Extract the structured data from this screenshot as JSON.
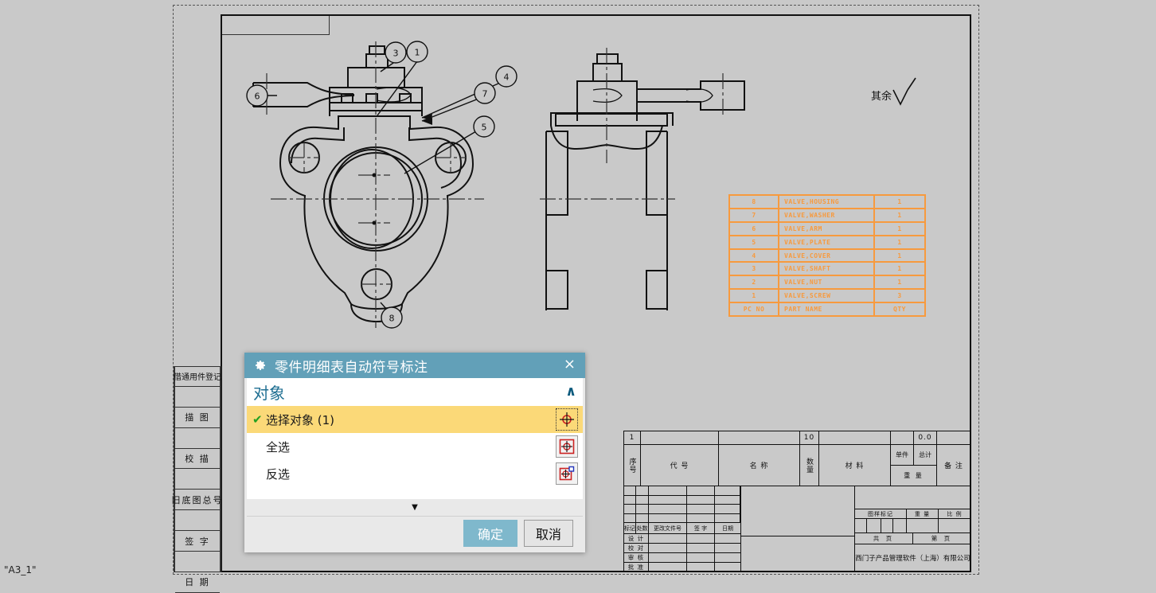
{
  "canvas": {
    "sheet_label": "\"A3_1\"",
    "surface_note": "其余",
    "balloons": [
      "3",
      "1",
      "4",
      "7",
      "6",
      "5",
      "8"
    ]
  },
  "bom": {
    "columns": [
      "PC NO",
      "PART NAME",
      "QTY"
    ],
    "rows": [
      {
        "no": "8",
        "name": "VALVE,HOUSING",
        "qty": "1"
      },
      {
        "no": "7",
        "name": "VALVE,WASHER",
        "qty": "1"
      },
      {
        "no": "6",
        "name": "VALVE,ARM",
        "qty": "1"
      },
      {
        "no": "5",
        "name": "VALVE,PLATE",
        "qty": "1"
      },
      {
        "no": "4",
        "name": "VALVE,COVER",
        "qty": "1"
      },
      {
        "no": "3",
        "name": "VALVE,SHAFT",
        "qty": "1"
      },
      {
        "no": "2",
        "name": "VALVE,NUT",
        "qty": "1"
      },
      {
        "no": "1",
        "name": "VALVE,SCREW",
        "qty": "3"
      }
    ],
    "header": {
      "no": "PC NO",
      "name": "PART NAME",
      "qty": "QTY"
    },
    "border_color": "#f79a3e"
  },
  "left_margin": {
    "items": [
      "借通用件登记",
      "描 图",
      "校 描",
      "旧底图总号",
      "签 字",
      "日 期"
    ]
  },
  "title_block": {
    "top_row": {
      "seq": "1",
      "qty": "10",
      "weight": "0.0"
    },
    "headers": {
      "seq": "序号",
      "code": "代 号",
      "name": "名 称",
      "qty": "数量",
      "material": "材 料",
      "unit_weight": "单件",
      "total_weight": "总计",
      "weight": "重 量",
      "remark": "备 注"
    },
    "revision_headers": [
      "标记",
      "处数",
      "更改文件号",
      "签 字",
      "日期"
    ],
    "signature_rows": [
      "设 计",
      "校 对",
      "审 核",
      "批 准"
    ],
    "right_headers": {
      "mark": "图样标记",
      "weight": "重 量",
      "scale": "比 例"
    },
    "pages": {
      "total": "共 页",
      "current": "第 页"
    },
    "company": "西门子产品管理软件（上海）有限公司"
  },
  "dialog": {
    "title": "零件明细表自动符号标注",
    "gear_icon": "gear-icon",
    "close_icon": "×",
    "group": {
      "title": "对象",
      "chevron": "∧"
    },
    "options": [
      {
        "label": "选择对象 (1)",
        "selected": true,
        "check": "✔",
        "icon": "select-object-icon"
      },
      {
        "label": "全选",
        "selected": false,
        "check": "",
        "icon": "select-all-icon"
      },
      {
        "label": "反选",
        "selected": false,
        "check": "",
        "icon": "invert-selection-icon"
      }
    ],
    "expand_chevron": "▼",
    "ok_label": "确定",
    "cancel_label": "取消",
    "colors": {
      "titlebar": "#62a0b8",
      "highlight": "#fbd978",
      "accent": "#1f6f92",
      "ok_button": "#7fb8cc"
    }
  }
}
